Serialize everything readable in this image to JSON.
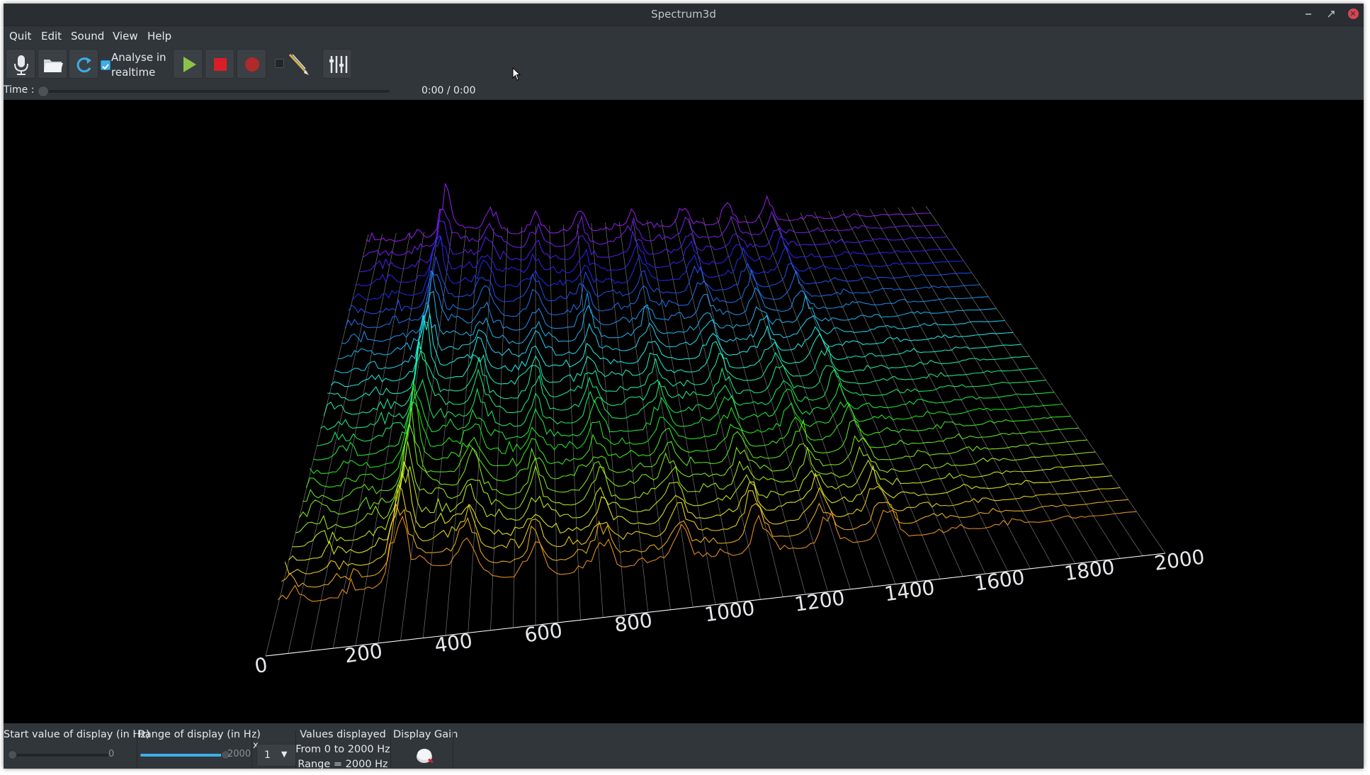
{
  "window": {
    "title": "Spectrum3d",
    "controls": [
      "minimize",
      "maximize",
      "close"
    ]
  },
  "menubar": [
    "Quit",
    "Edit",
    "Sound",
    "View",
    "Help"
  ],
  "toolbar": {
    "analyse_checked": true,
    "analyse_label": "Analyse in realtime",
    "icons": [
      "microphone-icon",
      "open-file-icon",
      "reload-icon",
      "play-icon",
      "stop-icon",
      "record-icon",
      "pointer-icon",
      "equalizer-icon"
    ]
  },
  "time": {
    "label": "Time :",
    "value": "0:00 / 0:00",
    "position_fraction": 0
  },
  "axis": {
    "ticks": [
      "0",
      "200",
      "400",
      "600",
      "800",
      "1000",
      "1200",
      "1400",
      "1600",
      "1800",
      "2000"
    ]
  },
  "bottom": {
    "start_label": "Start value of display (in Hz)",
    "start_value": "0",
    "start_fraction": 0,
    "range_label": "Range of display (in Hz)",
    "range_value": "2000",
    "range_fraction": 1,
    "multiplier_prefix": "x",
    "multiplier_value": "1",
    "values_title": "Values displayed",
    "values_from": "From 0 to 2000 Hz",
    "values_range": "Range = 2000 Hz",
    "gain_label": "Display Gain"
  },
  "colors": {
    "window_bg": "#31363b",
    "accent": "#3daee9",
    "play": "#8bc34a",
    "stop": "#da1e28",
    "record": "#b02a2a",
    "close": "#da4453"
  }
}
